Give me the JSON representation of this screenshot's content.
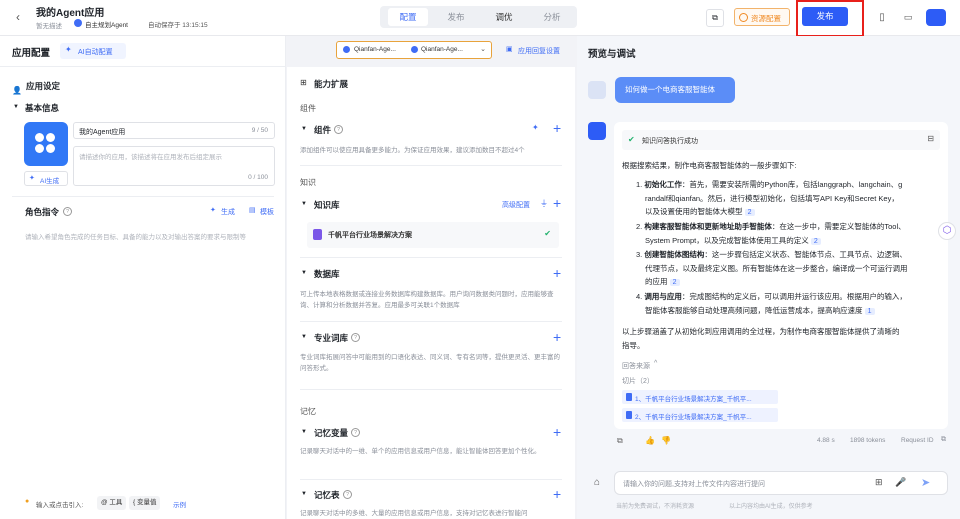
{
  "header": {
    "app_name": "我的Agent应用",
    "desc_hint": "暂无描述",
    "agent_type": "自主规划Agent",
    "autosave": "自动保存于 13:15:15",
    "tabs": [
      "配置",
      "发布",
      "调优",
      "分析"
    ],
    "resource_config": "资源配置",
    "publish": "发布"
  },
  "left": {
    "title": "应用配置",
    "ai_config": "AI自动配置",
    "model_a": "Qianfan-Age...",
    "model_b": "Qianfan-Age...",
    "reply_settings": "应用回复设置",
    "app_settings": "应用设定",
    "basic_info": "基本信息",
    "name_value": "我的Agent应用",
    "name_count": "9 / 50",
    "desc_placeholder": "请描述你的应用，该描述将在应用发布后组定展示",
    "desc_count": "0 / 100",
    "ai_generate": "AI生成",
    "role_title": "角色指令",
    "role_generate": "生成",
    "role_template": "模板",
    "role_placeholder": "请输入希望角色完成的任务目标、具备的能力以及对输出答案的要求与限制等",
    "tip_prefix": "输入或点击引入:",
    "tip_tool": "@ 工具",
    "tip_var": "{ 变量值",
    "tip_example": "示例"
  },
  "capability": {
    "title": "能力扩展",
    "group_components": "组件",
    "components_title": "组件",
    "components_desc": "添加组件可以使应用具备更多能力。为保证应用效果，建议添加数目不超过4个",
    "group_knowledge": "知识",
    "kb_title": "知识库",
    "kb_advanced": "高级配置",
    "kb_item": "千帆平台行业场景解决方案",
    "db_title": "数据库",
    "db_desc": "可上传本地表格数据或连接业务数据库构建数据库。用户询问数据类问题时，应用能够查询、计算和分析数据并答复。应用最多可关联1个数据库",
    "lexicon_title": "专业词库",
    "lexicon_desc": "专业词库拓展问答中可能用到的口语化表达、同义词、专有名词等，提供更灵活、更丰富的问答形式。",
    "group_memory": "记忆",
    "memvar_title": "记忆变量",
    "memvar_desc": "记录聊天对话中的一维、单个的应用信息或用户信息，能让智能体回答更加个性化。",
    "memtable_title": "记忆表",
    "memtable_desc": "记录聊天对话中的多维、大量的应用信息或用户信息，支持对记忆表进行智能问"
  },
  "preview": {
    "title": "预览与调试",
    "user_msg": "如何做一个电商客服智能体",
    "tool_status": "知识问答执行成功",
    "answer_intro": "根据搜索结果，制作电商客服智能体的一般步骤如下:",
    "steps": [
      {
        "n": "1.",
        "bold": "初始化工作",
        "lines": [
          "：首先，需要安装所需的Python库，包括langgraph、langchain、g",
          "randalf和qianfan。然后，进行模型初始化，包括填写API Key和Secret Key，",
          "以及设置使用的智能体大模型"
        ],
        "cite": "2"
      },
      {
        "n": "2.",
        "bold": "构建客服智能体和更新地址助手智能体",
        "lines": [
          "：在这一步中，需要定义智能体的Tool、",
          "System Prompt，以及完成智能体使用工具的定义"
        ],
        "cite": "2"
      },
      {
        "n": "3.",
        "bold": "创建智能体图结构",
        "lines": [
          "：这一步骤包括定义状态、智能体节点、工具节点、边逻辑、",
          "代理节点，以及最终定义图。所有智能体在这一步整合，编译成一个可运行调用",
          "的应用"
        ],
        "cite": "2"
      },
      {
        "n": "4.",
        "bold": "调用与应用",
        "lines": [
          "：完成图结构的定义后，可以调用并运行该应用。根据用户的输入，",
          "智能体客服能够自动处理高频问题，降低运营成本，提高响应速度"
        ],
        "cite": "1"
      }
    ],
    "summary": [
      "以上步骤涵盖了从初始化到应用调用的全过程，为制作电商客服智能体提供了清晰的",
      "指导。"
    ],
    "source_label": "回答来源",
    "slices_label": "切片（2）",
    "slice_1": "1、千帆平台行业场景解决方案_千帆平...",
    "slice_2": "2、千帆平台行业场景解决方案_千帆平...",
    "time": "4.88 s",
    "tokens": "1898 tokens",
    "request_id": "Request ID",
    "input_placeholder": "请输入你的问题,支持对上传文件内容进行提问",
    "disclaimer": "当前为免费调试，不消耗资源",
    "ai_note": "以上内容均由AI生成，仅供参考"
  },
  "colors": {
    "accent": "#3f6cf5",
    "publish_blue": "#2d5cf6",
    "highlight_red": "#e8201b",
    "user_bubble": "#5b8df7",
    "success_green": "#23b26d"
  }
}
